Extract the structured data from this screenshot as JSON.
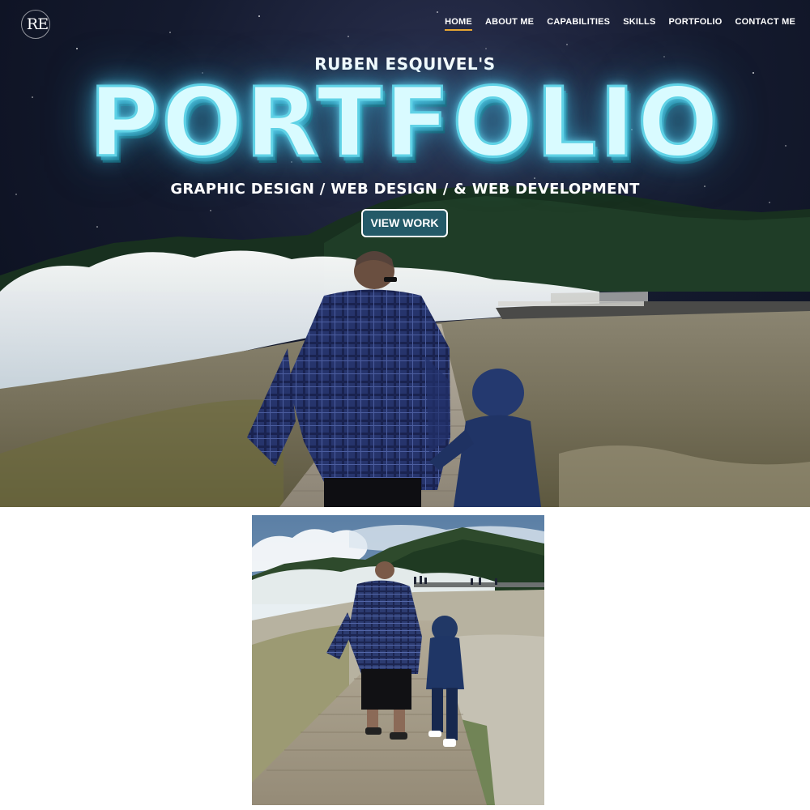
{
  "header": {
    "logo_text": "RE",
    "nav": [
      {
        "label": "HOME",
        "active": true
      },
      {
        "label": "ABOUT ME",
        "active": false
      },
      {
        "label": "CAPABILITIES",
        "active": false
      },
      {
        "label": "SKILLS",
        "active": false
      },
      {
        "label": "PORTFOLIO",
        "active": false
      },
      {
        "label": "CONTACT ME",
        "active": false
      }
    ]
  },
  "hero": {
    "subtitle": "RUBEN ESQUIVEL'S",
    "title": "PORTFOLIO",
    "tagline": "GRAPHIC DESIGN / WEB DESIGN / & WEB DEVELOPMENT",
    "cta_label": "VIEW WORK"
  },
  "colors": {
    "nav_active_underline": "#e8a632",
    "cta_background": "#245a68",
    "title_glow": "#5fd2e6"
  }
}
